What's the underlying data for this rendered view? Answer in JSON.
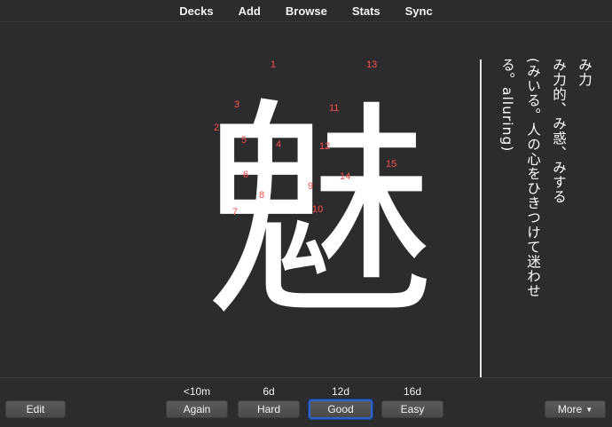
{
  "nav": {
    "decks": "Decks",
    "add": "Add",
    "browse": "Browse",
    "stats": "Stats",
    "sync": "Sync"
  },
  "card": {
    "kanji": "魅",
    "stroke_numbers": [
      "1",
      "2",
      "3",
      "4",
      "5",
      "6",
      "7",
      "8",
      "9",
      "10",
      "11",
      "12",
      "13",
      "14",
      "15"
    ],
    "reading_lines": [
      "み力",
      "み力的、み惑、みする",
      "(みいる。人の心をひきつけて迷わせ",
      "る。alluring)"
    ]
  },
  "answer": {
    "again_due": "<10m",
    "hard_due": "6d",
    "good_due": "12d",
    "easy_due": "16d",
    "edit_label": "Edit",
    "again_label": "Again",
    "hard_label": "Hard",
    "good_label": "Good",
    "easy_label": "Easy",
    "more_label": "More",
    "more_icon": "caret-down-icon"
  },
  "colors": {
    "background": "#2c2c2e",
    "stroke_number": "#ff4d4d",
    "good_focus": "#2b63c9"
  }
}
